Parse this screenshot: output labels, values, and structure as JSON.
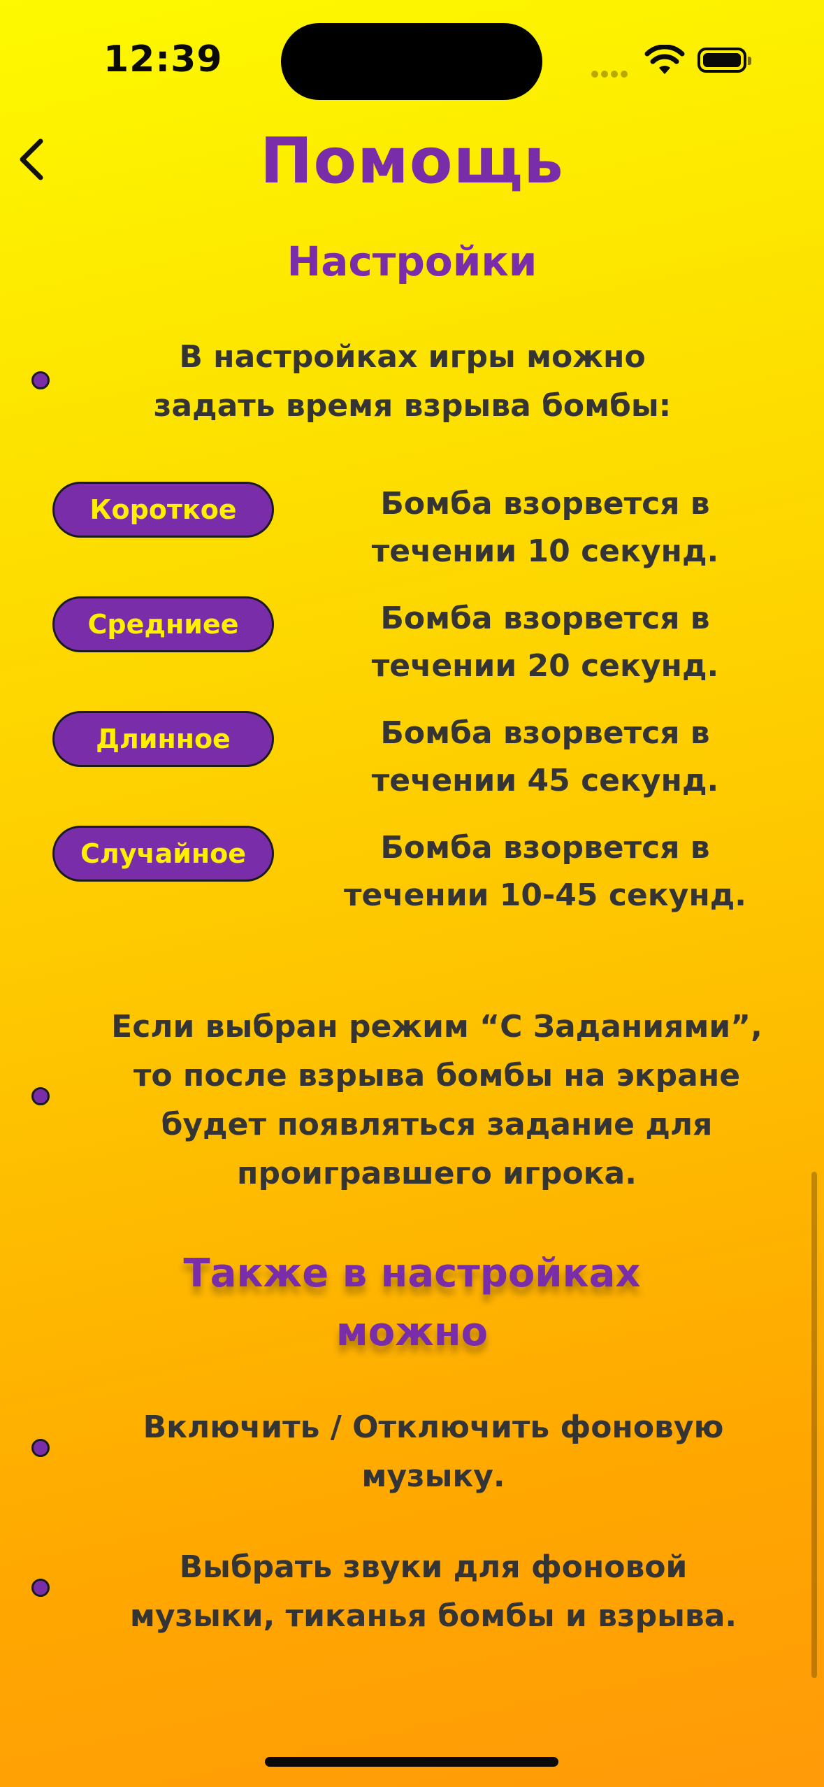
{
  "status_bar": {
    "time": "12:39"
  },
  "page": {
    "title": "Помощь",
    "section_title": "Настройки",
    "intro": [
      "В настройках игры можно",
      "задать время взрыва бомбы:"
    ],
    "durations": [
      {
        "label": "Короткое",
        "line1": "Бомба взорвется в",
        "line2": "течении 10 секунд."
      },
      {
        "label": "Средниее",
        "line1": "Бомба взорвется в",
        "line2": "течении 20 секунд."
      },
      {
        "label": "Длинное",
        "line1": "Бомба взорвется в",
        "line2": "течении 45 секунд."
      },
      {
        "label": "Случайное",
        "line1": "Бомба взорвется в",
        "line2": "течении 10-45 секунд."
      }
    ],
    "tasks_mode": [
      "Если выбран режим “С Заданиями”,",
      "то после взрыва бомбы на экране",
      "будет появляться задание для",
      "проигравшего игрока."
    ],
    "also_title": [
      "Также в настройках",
      "можно"
    ],
    "music_toggle": [
      "Включить / Отключить фоновую",
      "музыку."
    ],
    "sound_select": [
      "Выбрать звуки для фоновой",
      "музыки, тиканья бомбы и взрыва."
    ]
  },
  "colors": {
    "accent": "#7a2da8",
    "pill_text": "#fef000",
    "body_text": "#343434",
    "bg_top": "#fdf900",
    "bg_bottom": "#ff9a08"
  },
  "icons": {
    "back": "chevron-left-icon",
    "wifi": "wifi-icon",
    "battery": "battery-icon",
    "cell": "cellular-signal-icon"
  }
}
